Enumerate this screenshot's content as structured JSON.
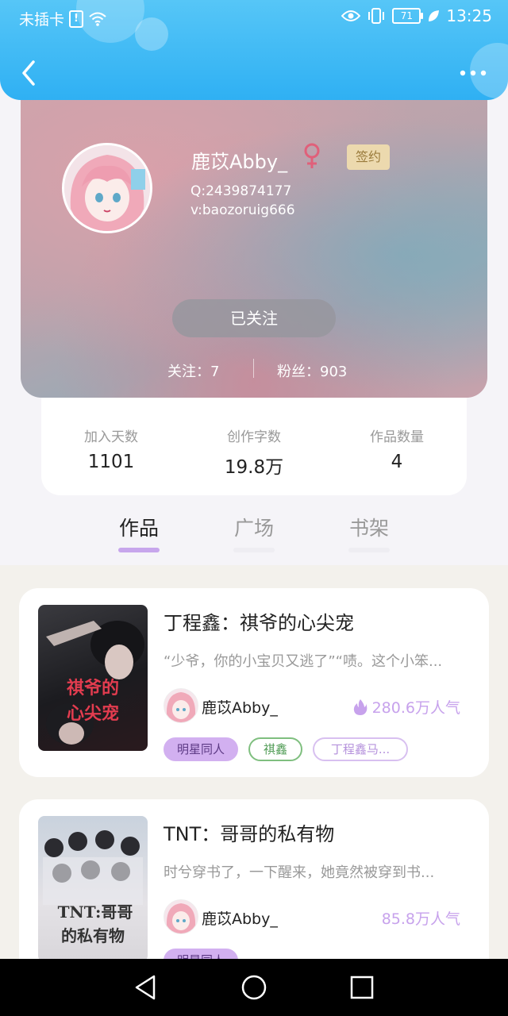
{
  "status_bar": {
    "carrier": "未插卡",
    "battery": "71",
    "time": "13:25"
  },
  "profile": {
    "name": "鹿苡Abby_",
    "badge": "签约",
    "qq": "Q:2439874177",
    "wechat": "v:baozoruig666",
    "follow_button": "已关注",
    "following": "关注：7",
    "fans": "粉丝：903"
  },
  "stats": [
    {
      "label": "加入天数",
      "value": "1101"
    },
    {
      "label": "创作字数",
      "value": "19.8万"
    },
    {
      "label": "作品数量",
      "value": "4"
    }
  ],
  "tabs": [
    {
      "label": "作品",
      "active": true
    },
    {
      "label": "广场",
      "active": false
    },
    {
      "label": "书架",
      "active": false
    }
  ],
  "books": [
    {
      "title": "丁程鑫：祺爷的心尖宠",
      "description": "“少爷，你的小宝贝又逃了”“啧。这个小笨...",
      "author": "鹿苡Abby_",
      "popularity": "280.6万人气",
      "cover_text": "祺爷的心尖宠",
      "tags": [
        "明星同人",
        "祺鑫",
        "丁程鑫马..."
      ]
    },
    {
      "title": "TNT：哥哥的私有物",
      "description": "时兮穿书了，一下醒来，她竟然被穿到书...",
      "author": "鹿苡Abby_",
      "popularity": "85.8万人气",
      "cover_text": "TNT:哥哥的私有物",
      "tags": [
        "明星同人"
      ]
    }
  ],
  "colors": {
    "header": "#2fb0f3",
    "accent_purple": "#c7a6ec",
    "female_icon": "#e0607a",
    "badge_bg": "#ecd9ae"
  }
}
